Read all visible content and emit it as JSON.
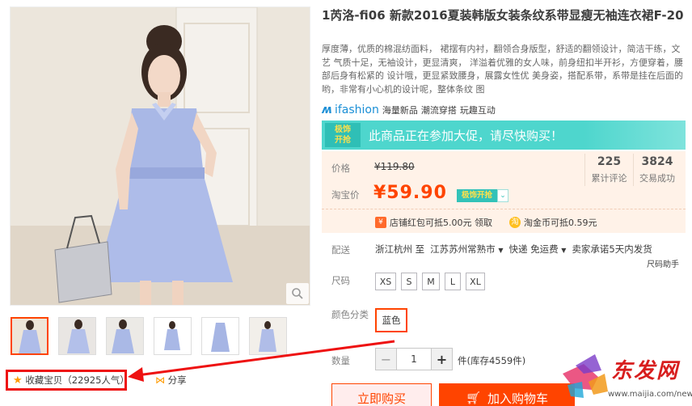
{
  "product": {
    "title": "1芮洛-fi06 新款2016夏装韩版女装条纹系带显瘦无袖连衣裙F-20",
    "description": "厚度薄，优质的棉混纺面料， 裙摆有内衬，翻领合身版型，舒适的翻领设计，简洁干练，文艺 气质十足，无袖设计，更显清爽， 洋溢着优雅的女人味，前身纽扣半开衫，方便穿着，腰部后身有松紧的 设计哦，更显紧致腰身，展露女性优 美身姿，搭配系带，系带是挂在后面的哟，非常有小心机的设计呢，整体条纹 图"
  },
  "ifashion": {
    "logo": "ifashion",
    "tags": [
      "海量新品",
      "潮流穿搭",
      "玩趣互动"
    ]
  },
  "promo": {
    "badge_top": "极饰",
    "badge_bottom": "开抢",
    "text": "此商品正在参加大促，请尽快购买！"
  },
  "price": {
    "label": "价格",
    "original": "¥119.80",
    "tb_label": "淘宝价",
    "current": "¥59.90",
    "tag": "极饰开抢"
  },
  "stats": {
    "reviews_value": "225",
    "reviews_label": "累计评论",
    "sales_value": "3824",
    "sales_label": "交易成功"
  },
  "coupons": {
    "shop_coupon": "店铺红包可抵5.00元 领取",
    "coin": "淘金币可抵0.59元"
  },
  "shipping": {
    "label": "配送",
    "from": "浙江杭州 至",
    "to": "江苏苏州常熟市",
    "express": "快递 免运费",
    "promise": "卖家承诺5天内发货"
  },
  "size": {
    "label": "尺码",
    "helper": "尺码助手",
    "options": [
      "XS",
      "S",
      "M",
      "L",
      "XL"
    ]
  },
  "color": {
    "label": "颜色分类",
    "selected": "蓝色"
  },
  "quantity": {
    "label": "数量",
    "value": "1",
    "minus": "−",
    "plus": "+",
    "stock": "件(库存4559件)"
  },
  "actions": {
    "buy_now": "立即购买",
    "add_cart": "加入购物车"
  },
  "favorite": {
    "label": "收藏宝贝（22925人气）"
  },
  "share": {
    "label": "分享"
  },
  "watermark": {
    "brand": "东发网",
    "url": "www.maijia.com/news"
  },
  "colors": {
    "accent": "#ff4400",
    "promo_bg": "#4ed6cd",
    "price_bg": "#fff2e8",
    "annotation_red": "#ee1111"
  }
}
